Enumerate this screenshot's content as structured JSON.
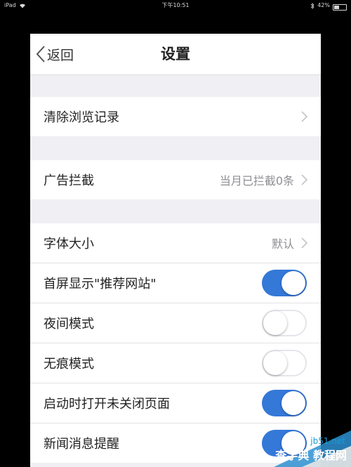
{
  "status_bar": {
    "device": "iPad",
    "time": "下午10:51",
    "battery": "42%",
    "battery_level": 0.42
  },
  "navbar": {
    "back_label": "返回",
    "title": "设置"
  },
  "groups": {
    "g1": [
      {
        "label": "清除浏览记录",
        "value": "",
        "type": "chevron"
      }
    ],
    "g2": [
      {
        "label": "广告拦截",
        "value": "当月已拦截0条",
        "type": "chevron"
      }
    ],
    "g3": [
      {
        "label": "字体大小",
        "value": "默认",
        "type": "chevron"
      },
      {
        "label": "首屏显示\"推荐网站\"",
        "type": "toggle",
        "on": true
      },
      {
        "label": "夜间模式",
        "type": "toggle",
        "on": false
      },
      {
        "label": "无痕模式",
        "type": "toggle",
        "on": false
      },
      {
        "label": "启动时打开未关闭页面",
        "type": "toggle",
        "on": true
      },
      {
        "label": "新闻消息提醒",
        "type": "toggle",
        "on": true
      }
    ]
  },
  "watermark": {
    "line1": "jb51.net",
    "line2": "查字典 教程网"
  },
  "colors": {
    "accent": "#3478d8",
    "background": "#efeff4"
  }
}
